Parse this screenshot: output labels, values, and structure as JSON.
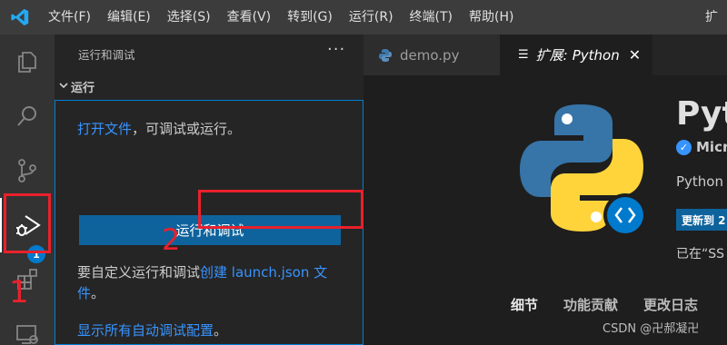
{
  "menu": [
    "文件(F)",
    "编辑(E)",
    "选择(S)",
    "查看(V)",
    "转到(G)",
    "运行(R)",
    "终端(T)",
    "帮助(H)"
  ],
  "title_right": "扩",
  "activity": {
    "icons": [
      "files-icon",
      "search-icon",
      "source-control-icon",
      "run-debug-icon",
      "extensions-icon",
      "remote-explorer-icon"
    ],
    "extensions_badge": "1",
    "annotation_number": "1"
  },
  "sidebar": {
    "header": "运行和调试",
    "more": "···",
    "section": "运行",
    "open_file_link": "打开文件",
    "open_file_suffix": "，可调试或运行。",
    "run_button": "运行和调试",
    "custom_prefix": "要自定义运行和调试",
    "create_link": "创建 launch.json 文件",
    "custom_suffix": "。",
    "show_all_link": "显示所有自动调试配置",
    "show_all_suffix": "。",
    "annotation_number": "2"
  },
  "tabs": {
    "demo": "demo.py",
    "ext_prefix": "扩展:",
    "ext_name": "Python",
    "close": "✕"
  },
  "extension": {
    "title": "Pyth",
    "publisher": "Micr",
    "description": "Python",
    "update_button": "更新到 2",
    "installed": "已在“SS",
    "tabs": [
      "细节",
      "功能贡献",
      "更改日志"
    ],
    "watermark": "CSDN @卍郝凝卍"
  },
  "colors": {
    "accent": "#007acc",
    "link": "#3794ff",
    "button": "#0e639c",
    "annotation_red": "#e8212c",
    "python_blue": "#3774a8",
    "python_yellow": "#ffd43b"
  }
}
